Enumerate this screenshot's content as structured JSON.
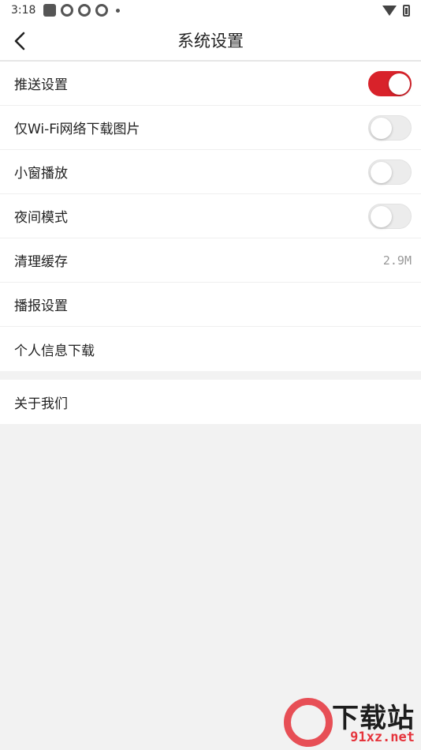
{
  "status_bar": {
    "time": "3:18",
    "notification_icons": [
      "app-notification-icon",
      "spinner-icon",
      "spinner-icon",
      "spinner-icon"
    ],
    "right_icons": [
      "wifi-icon",
      "battery-icon"
    ]
  },
  "app_bar": {
    "back_icon": "chevron-left-icon",
    "title": "系统设置"
  },
  "settings": {
    "push": {
      "label": "推送设置",
      "enabled": true
    },
    "wifi_images": {
      "label": "仅Wi-Fi网络下载图片",
      "enabled": false
    },
    "mini_window": {
      "label": "小窗播放",
      "enabled": false
    },
    "night_mode": {
      "label": "夜间模式",
      "enabled": false
    },
    "clear_cache": {
      "label": "清理缓存",
      "value": "2.9M"
    },
    "broadcast": {
      "label": "播报设置"
    },
    "personal_info": {
      "label": "个人信息下载"
    }
  },
  "about": {
    "label": "关于我们"
  },
  "watermark": {
    "line1": "下载站",
    "line2": "91xz.net"
  },
  "colors": {
    "accent": "#d8222a",
    "background": "#f2f2f2",
    "watermark_red": "#e5333b"
  }
}
